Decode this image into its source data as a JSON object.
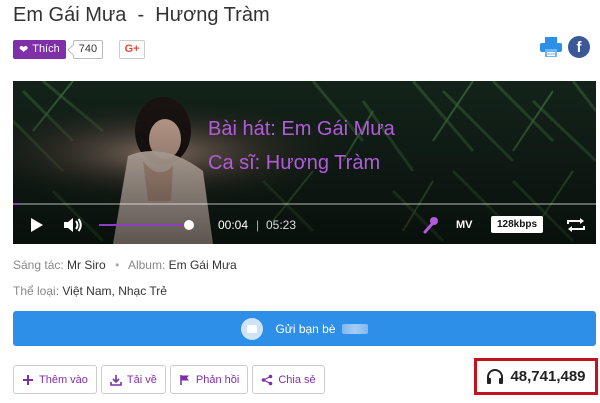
{
  "song": {
    "title": "Em Gái Mưa  -  Hương Tràm"
  },
  "social": {
    "like_label": "Thích",
    "like_count": "740",
    "gplus_label": "G+"
  },
  "player": {
    "lyric_line1": "Bài hát: Em Gái Mưa",
    "lyric_line2": "Ca sĩ: Hương Tràm",
    "current_time": "00:04",
    "separator": "|",
    "duration": "05:23",
    "progress": 0.0124,
    "volume": 0.92,
    "mv_label": "MV",
    "quality_label": "128kbps",
    "accent_color": "#8e3fc0",
    "icons": [
      "play-icon",
      "volume-icon",
      "karaoke-mic-icon",
      "repeat-icon"
    ]
  },
  "meta": {
    "composer_label": "Sáng tác:",
    "composer": "Mr Siro",
    "album_label": "Album:",
    "album": "Em Gái Mưa",
    "genre_label": "Thể loại:",
    "genre1": "Việt Nam",
    "genre_sep": ",",
    "genre2": "Nhạc Trẻ"
  },
  "send": {
    "label": "Gửi bạn bè",
    "color": "#2e8fe8"
  },
  "actions": {
    "add_label": "Thêm vào",
    "download_label": "Tải về",
    "feedback_label": "Phản hồi",
    "share_label": "Chia sẻ"
  },
  "stats": {
    "listen_count": "48,741,489",
    "highlight_color": "#c0141c"
  },
  "brand": {
    "purple": "#7f2fa8",
    "facebook": "#3b5998"
  }
}
